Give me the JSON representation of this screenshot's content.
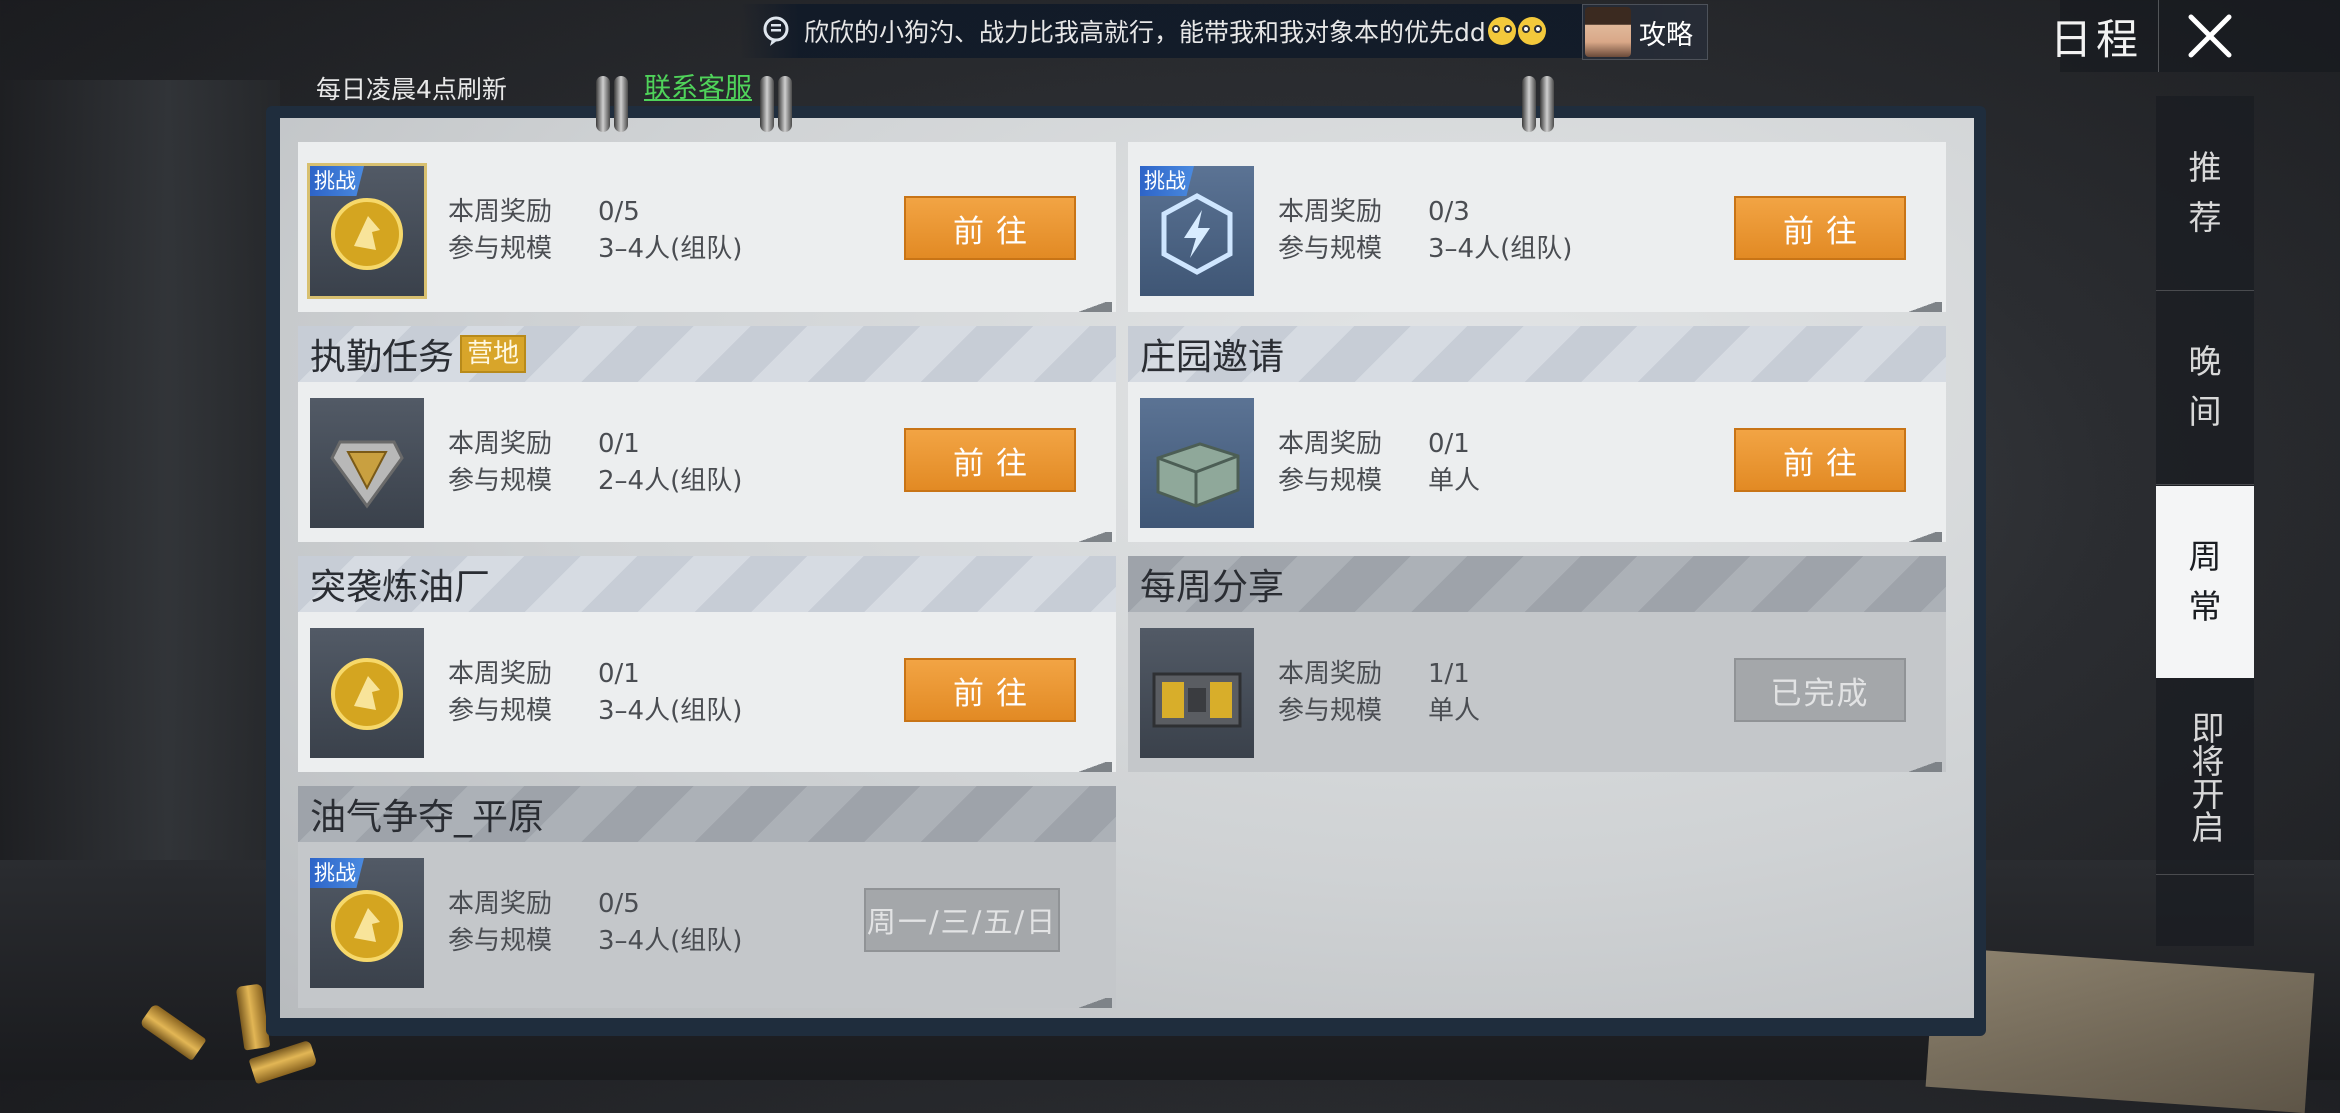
{
  "header": {
    "title": "日程",
    "refresh_note": "每日凌晨4点刷新",
    "contact_label": "联系客服",
    "ticker_text": "欣欣的小狗汋、战力比我高就行，能带我和我对象本的优先dd",
    "guide_label": "攻略"
  },
  "tabs": [
    {
      "line1": "推",
      "line2": "荐",
      "active": false
    },
    {
      "line1": "晚",
      "line2": "间",
      "active": false
    },
    {
      "line1": "周",
      "line2": "常",
      "active": true
    },
    {
      "line1": "即将",
      "line2": "开启",
      "active": false
    }
  ],
  "labels": {
    "reward": "本周奖励",
    "scale": "参与规模"
  },
  "challenge_tag": "挑战",
  "cards": [
    {
      "title": "",
      "tag": "",
      "challenge": true,
      "icon": "gold-coin-icon",
      "reward": "0/5",
      "scale": "3–4人(组队)",
      "button": "前往",
      "state": "go"
    },
    {
      "title": "",
      "tag": "",
      "challenge": true,
      "icon": "lightning-badge-icon",
      "reward": "0/3",
      "scale": "3–4人(组队)",
      "button": "前往",
      "state": "go"
    },
    {
      "title": "执勤任务",
      "tag": "营地",
      "challenge": false,
      "icon": "duty-badge-icon",
      "reward": "0/1",
      "scale": "2–4人(组队)",
      "button": "前往",
      "state": "go"
    },
    {
      "title": "庄园邀请",
      "tag": "",
      "challenge": false,
      "icon": "supply-crate-icon",
      "reward": "0/1",
      "scale": "单人",
      "button": "前往",
      "state": "go"
    },
    {
      "title": "突袭炼油厂",
      "tag": "",
      "challenge": false,
      "icon": "gold-coin-icon",
      "reward": "0/1",
      "scale": "3–4人(组队)",
      "button": "前往",
      "state": "go"
    },
    {
      "title": "每周分享",
      "tag": "",
      "challenge": false,
      "icon": "ammo-crate-icon",
      "reward": "1/1",
      "scale": "单人",
      "button": "已完成",
      "state": "done"
    },
    {
      "title": "油气争夺_平原",
      "tag": "",
      "challenge": true,
      "icon": "gold-coin-icon",
      "reward": "0/5",
      "scale": "3–4人(组队)",
      "button": "周一/三/五/日",
      "state": "locked"
    }
  ]
}
